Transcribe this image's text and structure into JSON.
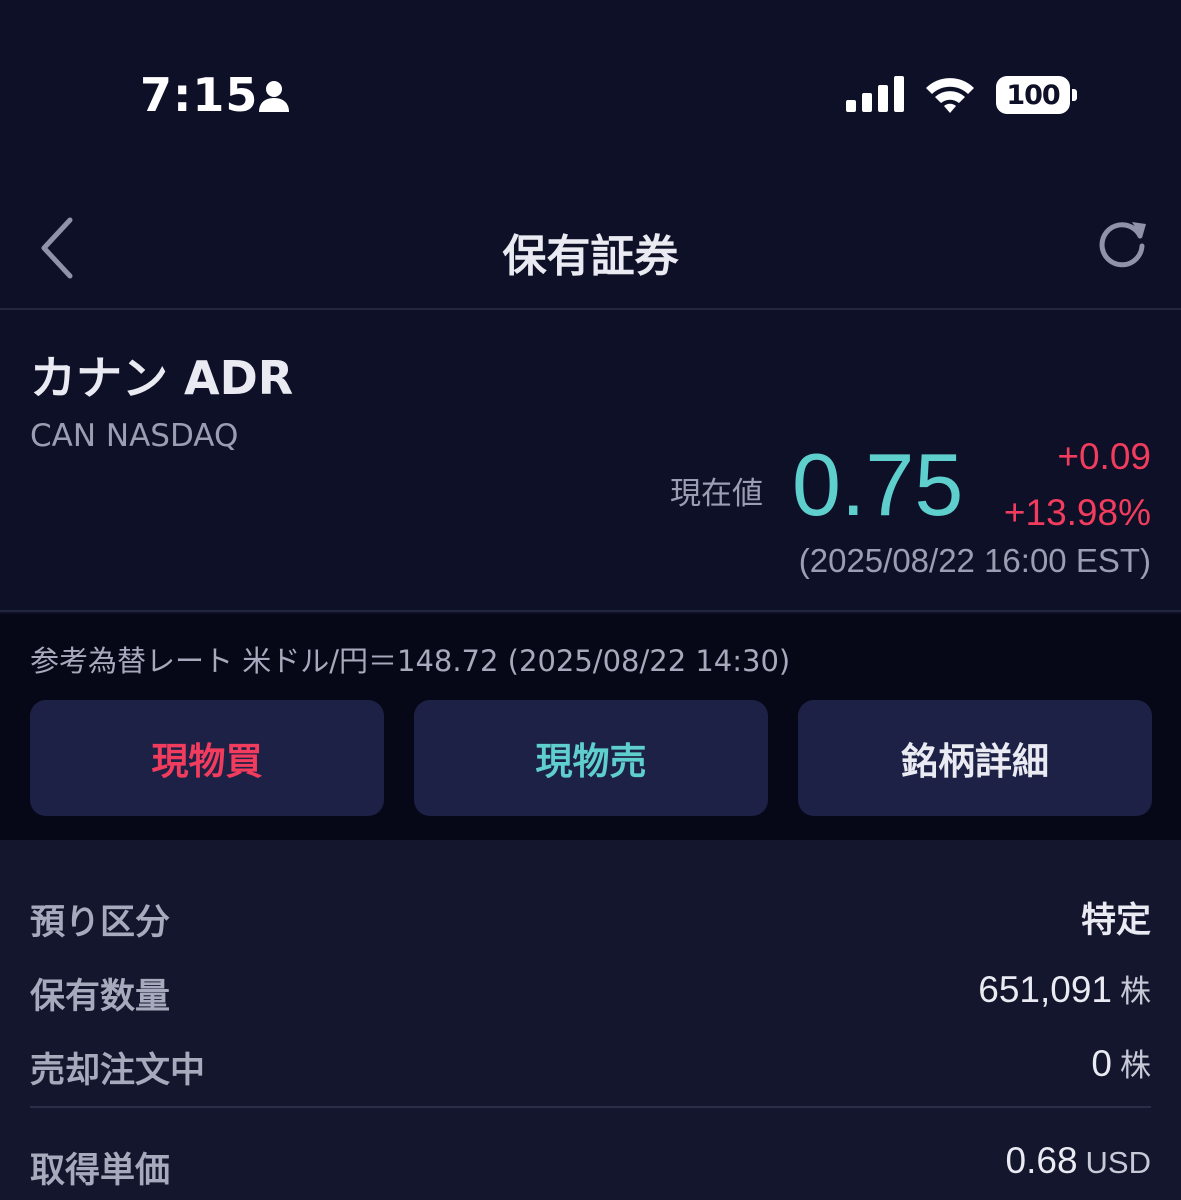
{
  "status_bar": {
    "time": "7:15",
    "battery": "100"
  },
  "nav": {
    "title": "保有証券"
  },
  "stock": {
    "name": "カナン ADR",
    "code": "CAN NASDAQ",
    "price_label": "現在値",
    "price": "0.75",
    "change": "+0.09",
    "change_pct": "+13.98%",
    "price_time": "(2025/08/22 16:00 EST)"
  },
  "fx": {
    "text": "参考為替レート 米ドル/円＝148.72 (2025/08/22 14:30)"
  },
  "actions": {
    "buy_label": "現物買",
    "sell_label": "現物売",
    "detail_label": "銘柄詳細"
  },
  "details": [
    {
      "label": "預り区分",
      "value": "特定",
      "unit": ""
    },
    {
      "label": "保有数量",
      "value": "651,091",
      "unit": "株"
    },
    {
      "label": "売却注文中",
      "value": "0",
      "unit": "株"
    },
    {
      "label": "取得単価",
      "value": "0.68",
      "unit": "USD"
    }
  ],
  "colors": {
    "background": "#0e1027",
    "up_red": "#f23c5e",
    "price_teal": "#5ecfcc",
    "button_bg": "#1e2146"
  }
}
